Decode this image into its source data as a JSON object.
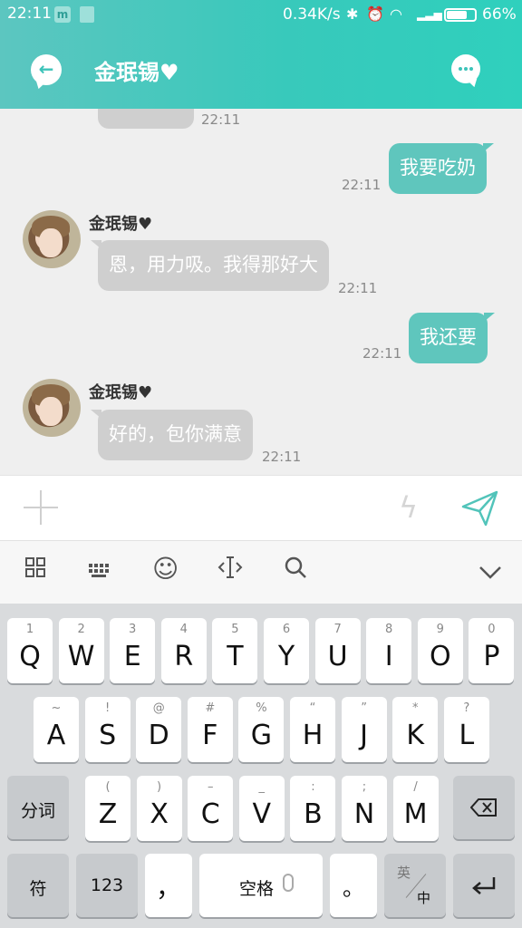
{
  "status_bar": {
    "time": "22:11",
    "notification_app": "m",
    "net_speed": "0.34K/s",
    "battery": "66%",
    "battery_level": 0.66
  },
  "header": {
    "title": "金珉锡♥"
  },
  "messages": [
    {
      "direction": "in",
      "text": "",
      "time": "22:11"
    },
    {
      "direction": "out",
      "text": "我要吃奶",
      "time": "22:11"
    },
    {
      "direction": "in",
      "sender": "金珉锡♥",
      "text": "恩，用力吸。我得那好大",
      "time": "22:11"
    },
    {
      "direction": "out",
      "text": "我还要",
      "time": "22:11"
    },
    {
      "direction": "in",
      "sender": "金珉锡♥",
      "text": "好的，包你满意",
      "time": "22:11"
    }
  ],
  "keyboard": {
    "row1": [
      {
        "main": "Q",
        "sub": "1"
      },
      {
        "main": "W",
        "sub": "2"
      },
      {
        "main": "E",
        "sub": "3"
      },
      {
        "main": "R",
        "sub": "4"
      },
      {
        "main": "T",
        "sub": "5"
      },
      {
        "main": "Y",
        "sub": "6"
      },
      {
        "main": "U",
        "sub": "7"
      },
      {
        "main": "I",
        "sub": "8"
      },
      {
        "main": "O",
        "sub": "9"
      },
      {
        "main": "P",
        "sub": "0"
      }
    ],
    "row2": [
      {
        "main": "A",
        "sub": "~"
      },
      {
        "main": "S",
        "sub": "!"
      },
      {
        "main": "D",
        "sub": "@"
      },
      {
        "main": "F",
        "sub": "#"
      },
      {
        "main": "G",
        "sub": "%"
      },
      {
        "main": "H",
        "sub": "“"
      },
      {
        "main": "J",
        "sub": "”"
      },
      {
        "main": "K",
        "sub": "*"
      },
      {
        "main": "L",
        "sub": "?"
      }
    ],
    "row3": [
      {
        "main": "Z",
        "sub": "("
      },
      {
        "main": "X",
        "sub": ")"
      },
      {
        "main": "C",
        "sub": "–"
      },
      {
        "main": "V",
        "sub": "_"
      },
      {
        "main": "B",
        "sub": ":"
      },
      {
        "main": "N",
        "sub": ";"
      },
      {
        "main": "M",
        "sub": "/"
      }
    ],
    "fenci": "分词",
    "fu": "符",
    "num": "123",
    "comma": "，",
    "space": "空格",
    "period": "。",
    "lang_top": "英",
    "lang_bottom": "中"
  }
}
